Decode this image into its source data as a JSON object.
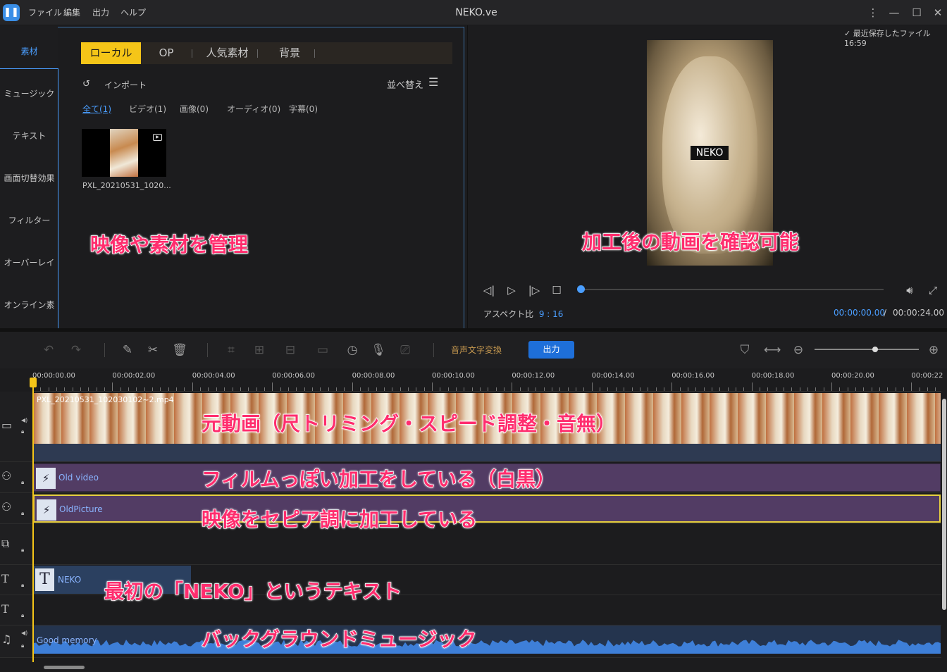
{
  "app": {
    "title": "NEKO.ve"
  },
  "menu": [
    "ファイル",
    "編集",
    "出力",
    "ヘルプ"
  ],
  "leftnav": [
    "素材",
    "ミュージック",
    "テキスト",
    "画面切替効果",
    "フィルター",
    "オーバーレイ",
    "オンライン素材"
  ],
  "media": {
    "tabs": [
      "ローカル",
      "OP",
      "人気素材",
      "背景"
    ],
    "import_label": "インポート",
    "sort_label": "並べ替え",
    "filters": [
      "全て(1)",
      "ビデオ(1)",
      "画像(0)",
      "オーディオ(0)",
      "字幕(0)"
    ],
    "file_name": "PXL_20210531_1020..."
  },
  "preview": {
    "autosave": "最近保存したファイル 16:59",
    "overlay_text": "NEKO",
    "aspect_label": "アスペクト比",
    "aspect_value": "9 : 16",
    "time_current": "00:00:00.00",
    "time_separator": "/",
    "time_total": "00:00:24.00",
    "progress": 0
  },
  "toolbar": {
    "speech_to_text": "音声文字変換",
    "export": "出力",
    "zoom_level": 0.58
  },
  "ruler": [
    "00:00:00.00",
    "00:00:02.00",
    "00:00:04.00",
    "00:00:06.00",
    "00:00:08.00",
    "00:00:10.00",
    "00:00:12.00",
    "00:00:14.00",
    "00:00:16.00",
    "00:00:18.00",
    "00:00:20.00",
    "00:00:22"
  ],
  "tracks": {
    "video_clip": "PXL_20210531_102030102~2.mp4",
    "fx1": "Old video",
    "fx2": "OldPicture",
    "text_clip": "NEKO",
    "audio_clip": "Good memory"
  },
  "annotations": {
    "media": "映像や素材を管理",
    "preview": "加工後の動画を確認可能",
    "video": "元動画（尺トリミング・スピード調整・音無）",
    "fx1": "フィルムっぽい加工をしている（白黒）",
    "fx2": "映像をセピア調に加工している",
    "text": "最初の「NEKO」というテキスト",
    "audio": "バックグラウンドミュージック"
  },
  "colors": {
    "accent": "#4a9eff",
    "tab_active": "#f5c518",
    "annotation": "#ff2d6e",
    "export": "#1e6fd9",
    "fx_clip": "#523c64"
  }
}
